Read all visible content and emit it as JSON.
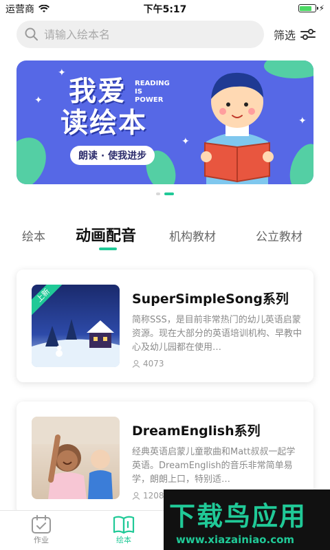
{
  "status": {
    "carrier": "运营商",
    "time": "下午5:17",
    "battery_level": 0.8
  },
  "search": {
    "placeholder": "请输入绘本名",
    "filter_label": "筛选"
  },
  "banner": {
    "title_line1": "我爱",
    "title_line2": "读绘本",
    "english": "READING\nIS\nPOWER",
    "slogan": "朗读 · 使我进步",
    "page_count": 2,
    "active_page": 1
  },
  "tabs": [
    {
      "label": "绘本",
      "active": false
    },
    {
      "label": "动画配音",
      "active": true
    },
    {
      "label": "机构教材",
      "active": false
    },
    {
      "label": "公立教材",
      "active": false
    }
  ],
  "cards": [
    {
      "title": "SuperSimpleSong系列",
      "desc": "简称SSS，是目前非常热门的幼儿英语启蒙资源。现在大部分的英语培训机构、早教中心及幼儿园都在使用…",
      "views": "4073",
      "badge": "上新"
    },
    {
      "title": "DreamEnglish系列",
      "desc": "经典英语启蒙儿童歌曲和Matt叔叔一起学英语。DreamEnglish的音乐非常简单易学，朗朗上口，特别适…",
      "views": "1208"
    }
  ],
  "bottom_nav": [
    {
      "label": "作业",
      "icon": "calendar-check-icon",
      "active": false
    },
    {
      "label": "绘本",
      "icon": "open-book-icon",
      "active": true
    }
  ],
  "watermark": {
    "big": "下载鸟应用",
    "small": "www.xiazainiao.com"
  },
  "colors": {
    "accent": "#20c997",
    "banner": "#5668e6"
  }
}
